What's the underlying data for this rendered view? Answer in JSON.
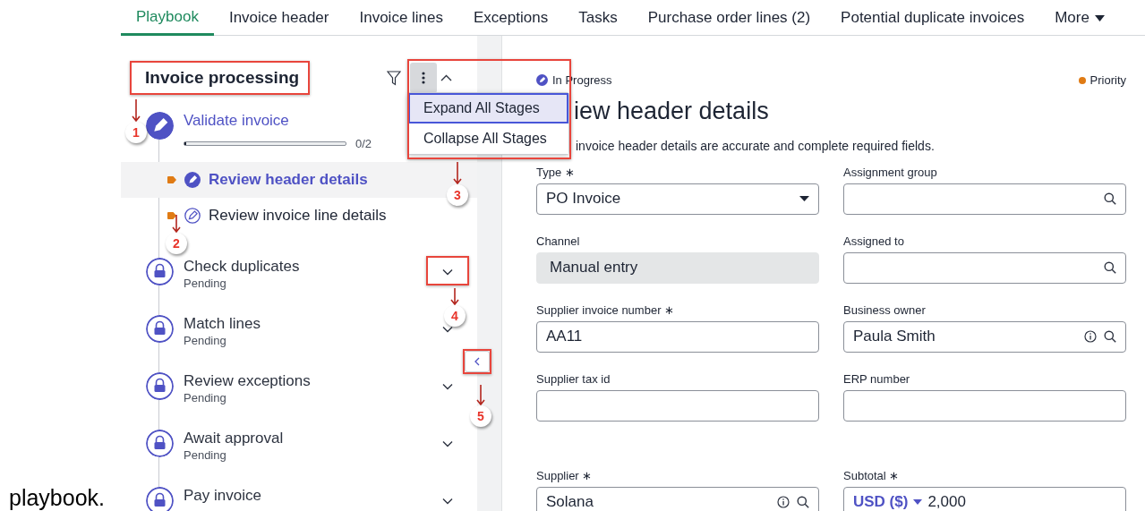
{
  "tabs": [
    {
      "label": "Playbook",
      "selected": true
    },
    {
      "label": "Invoice header",
      "selected": false
    },
    {
      "label": "Invoice lines",
      "selected": false
    },
    {
      "label": "Exceptions",
      "selected": false
    },
    {
      "label": "Tasks",
      "selected": false
    },
    {
      "label": "Purchase order lines (2)",
      "selected": false
    },
    {
      "label": "Potential duplicate invoices",
      "selected": false
    },
    {
      "label": "More",
      "selected": false,
      "kind": "dropdown"
    }
  ],
  "playbook": {
    "title": "Invoice processing",
    "menu_open": true,
    "menu": [
      {
        "label": "Expand All Stages",
        "selected": true
      },
      {
        "label": "Collapse All Stages",
        "selected": false
      }
    ],
    "stages": [
      {
        "title": "Validate invoice",
        "kind": "active",
        "expanded": true,
        "level": 0.01,
        "reading": "0/2",
        "tasks": [
          {
            "title": "Review header details",
            "selected": true
          },
          {
            "title": "Review invoice line details",
            "selected": false
          }
        ]
      },
      {
        "title": "Check duplicates",
        "kind": "locked",
        "status": "Pending",
        "expanded": false
      },
      {
        "title": "Match lines",
        "kind": "locked",
        "status": "Pending",
        "expanded": false
      },
      {
        "title": "Review exceptions",
        "kind": "locked",
        "status": "Pending",
        "expanded": false
      },
      {
        "title": "Await approval",
        "kind": "locked",
        "status": "Pending",
        "expanded": false
      },
      {
        "title": "Pay invoice",
        "kind": "locked",
        "expanded": false
      }
    ]
  },
  "task_panel": {
    "status": "In Progress",
    "priority": "Priority",
    "title": "iew header details",
    "description": "invoice header details are accurate and complete required fields.",
    "fields": [
      {
        "label": "Type ∗",
        "kind": "select",
        "value": "PO Invoice"
      },
      {
        "label": "Assignment group",
        "kind": "lookup"
      },
      {
        "label": "Channel",
        "kind": "readonly",
        "value": "Manual entry"
      },
      {
        "label": "Assigned to",
        "kind": "lookup"
      },
      {
        "label": "Supplier invoice number ∗",
        "kind": "text",
        "value": "AA11"
      },
      {
        "label": "Business owner",
        "kind": "lookup",
        "value": "Paula Smith",
        "info": true
      },
      {
        "label": "Supplier tax id",
        "kind": "text"
      },
      {
        "label": "ERP number",
        "kind": "text"
      },
      {
        "label": "Supplier ∗",
        "kind": "lookup",
        "value": "Solana",
        "info": true
      },
      {
        "label": "Subtotal ∗",
        "kind": "currency",
        "currency": "USD ($)",
        "value": "2,000"
      }
    ]
  },
  "annotations": [
    {
      "number": "1"
    },
    {
      "number": "2"
    },
    {
      "number": "3"
    },
    {
      "number": "4"
    },
    {
      "number": "5"
    }
  ],
  "caption": "playbook."
}
